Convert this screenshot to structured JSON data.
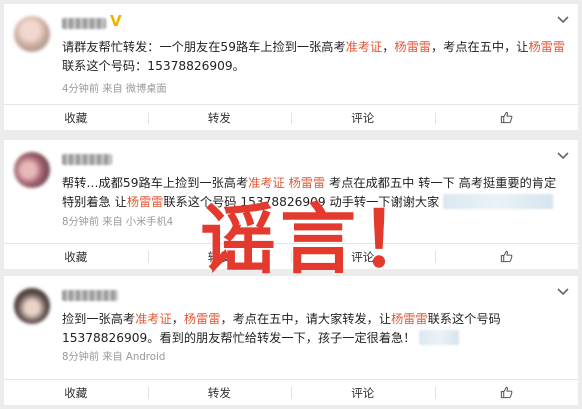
{
  "posts": [
    {
      "id": "post-1",
      "content": [
        {
          "text": "请群友帮忙转发：一个朋友在59路车上捡到一张高考",
          "hl": false
        },
        {
          "text": "准考证",
          "hl": true
        },
        {
          "text": "，",
          "hl": false
        },
        {
          "text": "杨雷雷",
          "hl": true
        },
        {
          "text": "，考点在五中，让",
          "hl": false
        },
        {
          "text": "杨雷雷",
          "hl": true
        },
        {
          "text": "联系这个号码：15378826909。",
          "hl": false
        }
      ],
      "meta": "4分钟前  来自 微博桌面"
    },
    {
      "id": "post-2",
      "content": [
        {
          "text": "帮转…成都59路车上捡到一张高考",
          "hl": false
        },
        {
          "text": "准考证",
          "hl": true
        },
        {
          "text": " ",
          "hl": false
        },
        {
          "text": "杨雷雷",
          "hl": true
        },
        {
          "text": " 考点在成都五中 转一下 高考挺重要的肯定特别着急 让",
          "hl": false
        },
        {
          "text": "杨雷雷",
          "hl": true
        },
        {
          "text": "联系这个号码 15378826909 动手转一下谢谢大家",
          "hl": false
        }
      ],
      "meta": "8分钟前  来自 小米手机4"
    },
    {
      "id": "post-3",
      "content": [
        {
          "text": "捡到一张高考",
          "hl": false
        },
        {
          "text": "准考证",
          "hl": true
        },
        {
          "text": "，",
          "hl": false
        },
        {
          "text": "杨雷雷",
          "hl": true
        },
        {
          "text": "，考点在五中，请大家转发，让",
          "hl": false
        },
        {
          "text": "杨雷雷",
          "hl": true
        },
        {
          "text": "联系这个号码15378826909。看到的朋友帮忙给转发一下，孩子一定很着急！",
          "hl": false
        }
      ],
      "meta": "8分钟前  来自 Android"
    }
  ],
  "actions": {
    "favorite": "收藏",
    "repost": "转发",
    "comment": "评论"
  },
  "stamp": "谣言！",
  "colors": {
    "highlight": "#e05a3a",
    "stamp": "#e43a2e",
    "vip": "#f0b400"
  },
  "icons": {
    "vip": "vip-v-icon",
    "menu": "chevron-down-icon",
    "like": "thumbs-up-icon"
  }
}
